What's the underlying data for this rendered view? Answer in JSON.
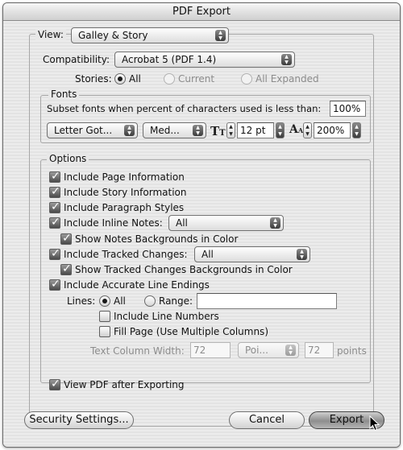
{
  "window": {
    "title": "PDF Export"
  },
  "view": {
    "label": "View:",
    "value": "Galley & Story"
  },
  "compatibility": {
    "label": "Compatibility:",
    "value": "Acrobat 5 (PDF 1.4)"
  },
  "stories": {
    "label": "Stories:",
    "options": [
      "All",
      "Current",
      "All Expanded"
    ],
    "selected": "All"
  },
  "fonts": {
    "legend": "Fonts",
    "subset_label": "Subset fonts when percent of characters used is less than:",
    "subset_value": "100%",
    "font_family": "Letter Got...",
    "font_style": "Med...",
    "font_size": "12 pt",
    "leading": "200%"
  },
  "options": {
    "legend": "Options",
    "include_page_info": "Include Page Information",
    "include_story_info": "Include Story Information",
    "include_paragraph_styles": "Include Paragraph Styles",
    "include_inline_notes": "Include Inline Notes:",
    "inline_notes_value": "All",
    "show_notes_backgrounds": "Show Notes Backgrounds in Color",
    "include_tracked_changes": "Include Tracked Changes:",
    "tracked_changes_value": "All",
    "show_tracked_backgrounds": "Show Tracked Changes Backgrounds in Color",
    "include_line_endings": "Include Accurate Line Endings",
    "lines_label": "Lines:",
    "lines_all": "All",
    "lines_range": "Range:",
    "range_value": "",
    "include_line_numbers": "Include Line Numbers",
    "fill_page": "Fill Page (Use Multiple Columns)",
    "text_column_width_label": "Text Column Width:",
    "text_column_width_value": "72",
    "units_value": "Poi...",
    "points_value": "72",
    "points_label": "points"
  },
  "view_pdf_after": "View PDF after Exporting",
  "buttons": {
    "security": "Security Settings...",
    "cancel": "Cancel",
    "export": "Export"
  },
  "icons": {
    "font_size": "font-size-icon",
    "leading": "leading-icon",
    "cursor": "arrow-cursor-icon"
  },
  "colors": {
    "window_bg": "#e6e6e6",
    "default_button": "#9a9a9a",
    "disabled_text": "#8c8c8c"
  }
}
